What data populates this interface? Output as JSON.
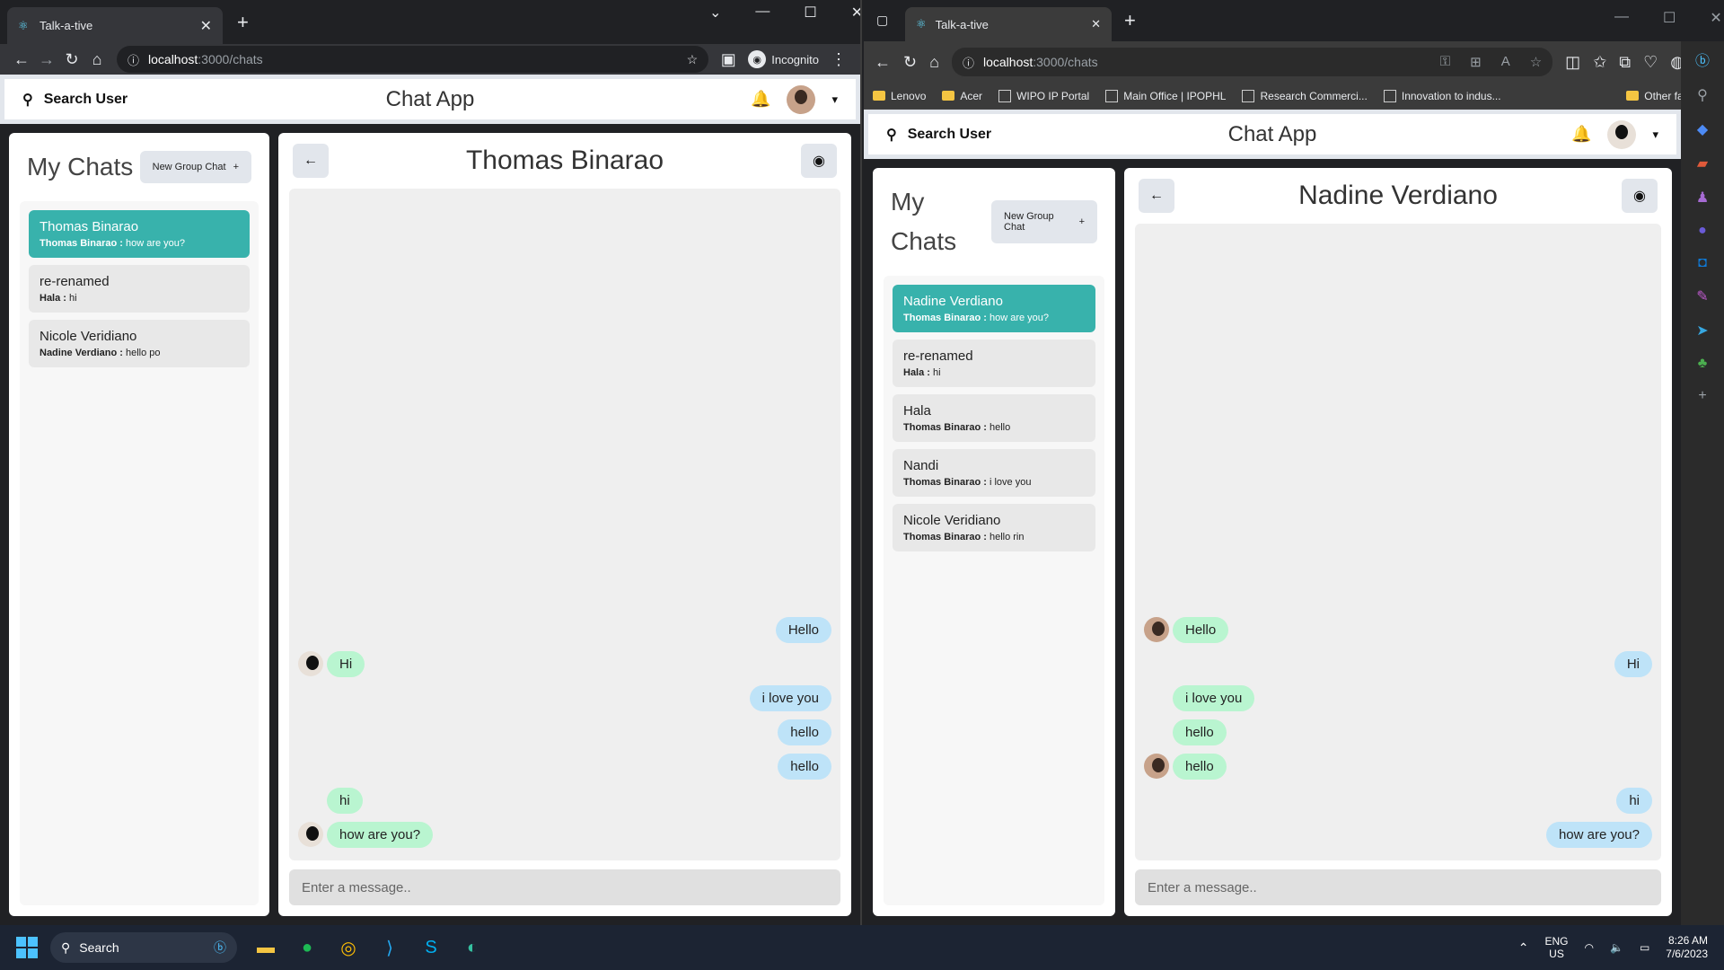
{
  "left_browser": {
    "tab_title": "Talk-a-tive",
    "url_host": "localhost",
    "url_path": ":3000/chats",
    "profile_label": "Incognito",
    "app": {
      "search_label": "Search User",
      "app_title": "Chat App",
      "my_chats_title": "My Chats",
      "new_group_label": "New Group Chat",
      "chat_list": [
        {
          "name": "Thomas Binarao",
          "sender": "Thomas Binarao :",
          "preview": "how are you?",
          "active": true
        },
        {
          "name": "re-renamed",
          "sender": "Hala :",
          "preview": "hi",
          "active": false
        },
        {
          "name": "Nicole Veridiano",
          "sender": "Nadine Verdiano :",
          "preview": "hello po",
          "active": false
        }
      ],
      "chat_name": "Thomas Binarao",
      "messages": [
        {
          "text": "Hello",
          "mine": true
        },
        {
          "text": "Hi",
          "mine": false
        },
        {
          "text": "i love you",
          "mine": true
        },
        {
          "text": "hello",
          "mine": true
        },
        {
          "text": "hello",
          "mine": true
        },
        {
          "text": "hi",
          "mine": false
        },
        {
          "text": "how are you?",
          "mine": false
        }
      ],
      "input_placeholder": "Enter a message.."
    }
  },
  "right_browser": {
    "tab_title": "Talk-a-tive",
    "url_host": "localhost",
    "url_path": ":3000/chats",
    "favorites": [
      "Lenovo",
      "Acer",
      "WIPO IP Portal",
      "Main Office | IPOPHL",
      "Research Commerci...",
      "Innovation to indus...",
      "Other favorites"
    ],
    "app": {
      "search_label": "Search User",
      "app_title": "Chat App",
      "my_chats_title": "My Chats",
      "new_group_label": "New Group Chat",
      "chat_list": [
        {
          "name": "Nadine Verdiano",
          "sender": "Thomas Binarao :",
          "preview": "how are you?",
          "active": true
        },
        {
          "name": "re-renamed",
          "sender": "Hala :",
          "preview": "hi",
          "active": false
        },
        {
          "name": "Hala",
          "sender": "Thomas Binarao :",
          "preview": "hello",
          "active": false
        },
        {
          "name": "Nandi",
          "sender": "Thomas Binarao :",
          "preview": "i love you",
          "active": false
        },
        {
          "name": "Nicole Veridiano",
          "sender": "Thomas Binarao :",
          "preview": "hello rin",
          "active": false
        }
      ],
      "chat_name": "Nadine Verdiano",
      "messages": [
        {
          "text": "Hello",
          "mine": false
        },
        {
          "text": "Hi",
          "mine": true
        },
        {
          "text": "i love you",
          "mine": false
        },
        {
          "text": "hello",
          "mine": false
        },
        {
          "text": "hello",
          "mine": false
        },
        {
          "text": "hi",
          "mine": true
        },
        {
          "text": "how are you?",
          "mine": true
        }
      ],
      "input_placeholder": "Enter a message.."
    }
  },
  "taskbar": {
    "search_label": "Search",
    "lang_top": "ENG",
    "lang_bottom": "US",
    "time": "8:26 AM",
    "date": "7/6/2023"
  },
  "colors": {
    "active_chat": "#38b2ac",
    "outgoing_bubble": "#bee3f8",
    "incoming_bubble": "#b9f5d0"
  }
}
